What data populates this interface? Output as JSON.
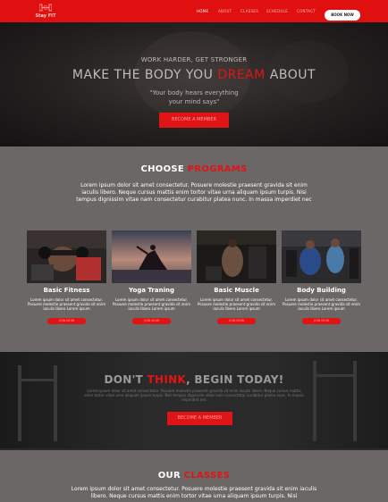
{
  "header": {
    "logo_text": "Stay FIT",
    "nav": [
      {
        "label": "HOME",
        "active": true
      },
      {
        "label": "ABOUT",
        "active": false
      },
      {
        "label": "CLASSES",
        "active": false
      },
      {
        "label": "SCHEDULE",
        "active": false
      },
      {
        "label": "CONTACT",
        "active": false
      }
    ],
    "book_now": "BOOK NOW"
  },
  "hero": {
    "subtitle": "WORK HARDER, GET STRONGER",
    "title_pre": "MAKE THE BODY YOU ",
    "title_highlight": "DREAM",
    "title_post": " ABOUT",
    "quote_line1": "\"Your body hears everything",
    "quote_line2": "your mind says\"",
    "button": "BECOME A MEMBER"
  },
  "programs": {
    "title_pre": "CHOOSE ",
    "title_highlight": "PROGRAMS",
    "description": "Lorem ipsum dolor sit amet consectetur. Posuere molestie praesent gravida sit enim iaculis libero. Neque cursus mattis enim tortor vitae urna aliquam ipsum turpis. Nisi tempus dignissim vitae nam consectetur curabitur platea nunc. In massa imperdiet nec",
    "cards": [
      {
        "title": "Basic Fitness",
        "text": "Lorem ipsum dolor sit amet consectetur. Posuere molestie praesent gravida sit enim iaculis libero Lorem ipsum",
        "button": "JOIN NOW",
        "image": "gym-weights-photo"
      },
      {
        "title": "Yoga Traning",
        "text": "Lorem ipsum dolor sit amet consectetur. Posuere molestie praesent gravida sit enim iaculis libero Lorem ipsum",
        "button": "JOIN NOW",
        "image": "yoga-sunset-photo"
      },
      {
        "title": "Basic Muscle",
        "text": "Lorem ipsum dolor sit amet consectetur. Posuere molestie praesent gravida sit enim iaculis libero Lorem ipsum",
        "button": "JOIN NOW",
        "image": "muscle-training-photo"
      },
      {
        "title": "Body Building",
        "text": "Lorem ipsum dolor sit amet consectetur. Posuere molestie praesent gravida sit enim iaculis libero Lorem ipsum",
        "button": "JOIN NOW",
        "image": "bodybuilding-photo"
      }
    ]
  },
  "cta": {
    "title_pre": "DON'T ",
    "title_highlight": "THINK",
    "title_post": ", BEGIN TODAY!",
    "text": "Lorem ipsum dolor sit amet consectetur. Posuere molestie praesent gravida sit enim iaculis libero. Neque cursus mattis enim tortor vitae urna aliquam ipsum turpis. Nisi tempus dignissim vitae nam consectetur curabitur platea nunc. In massa imperdiet nec",
    "button": "BECOME A MEMBER"
  },
  "classes": {
    "title_pre": "OUR ",
    "title_highlight": "CLASSES",
    "description": "Lorem ipsum dolor sit amet consectetur. Posuere molestie praesent gravida sit enim iaculis libero. Neque cursus mattis enim tortor vitae urna aliquam ipsum turpis. Nisi"
  },
  "colors": {
    "accent": "#e01414",
    "header_bg": "#e01010",
    "section_gray": "#6b6766"
  }
}
